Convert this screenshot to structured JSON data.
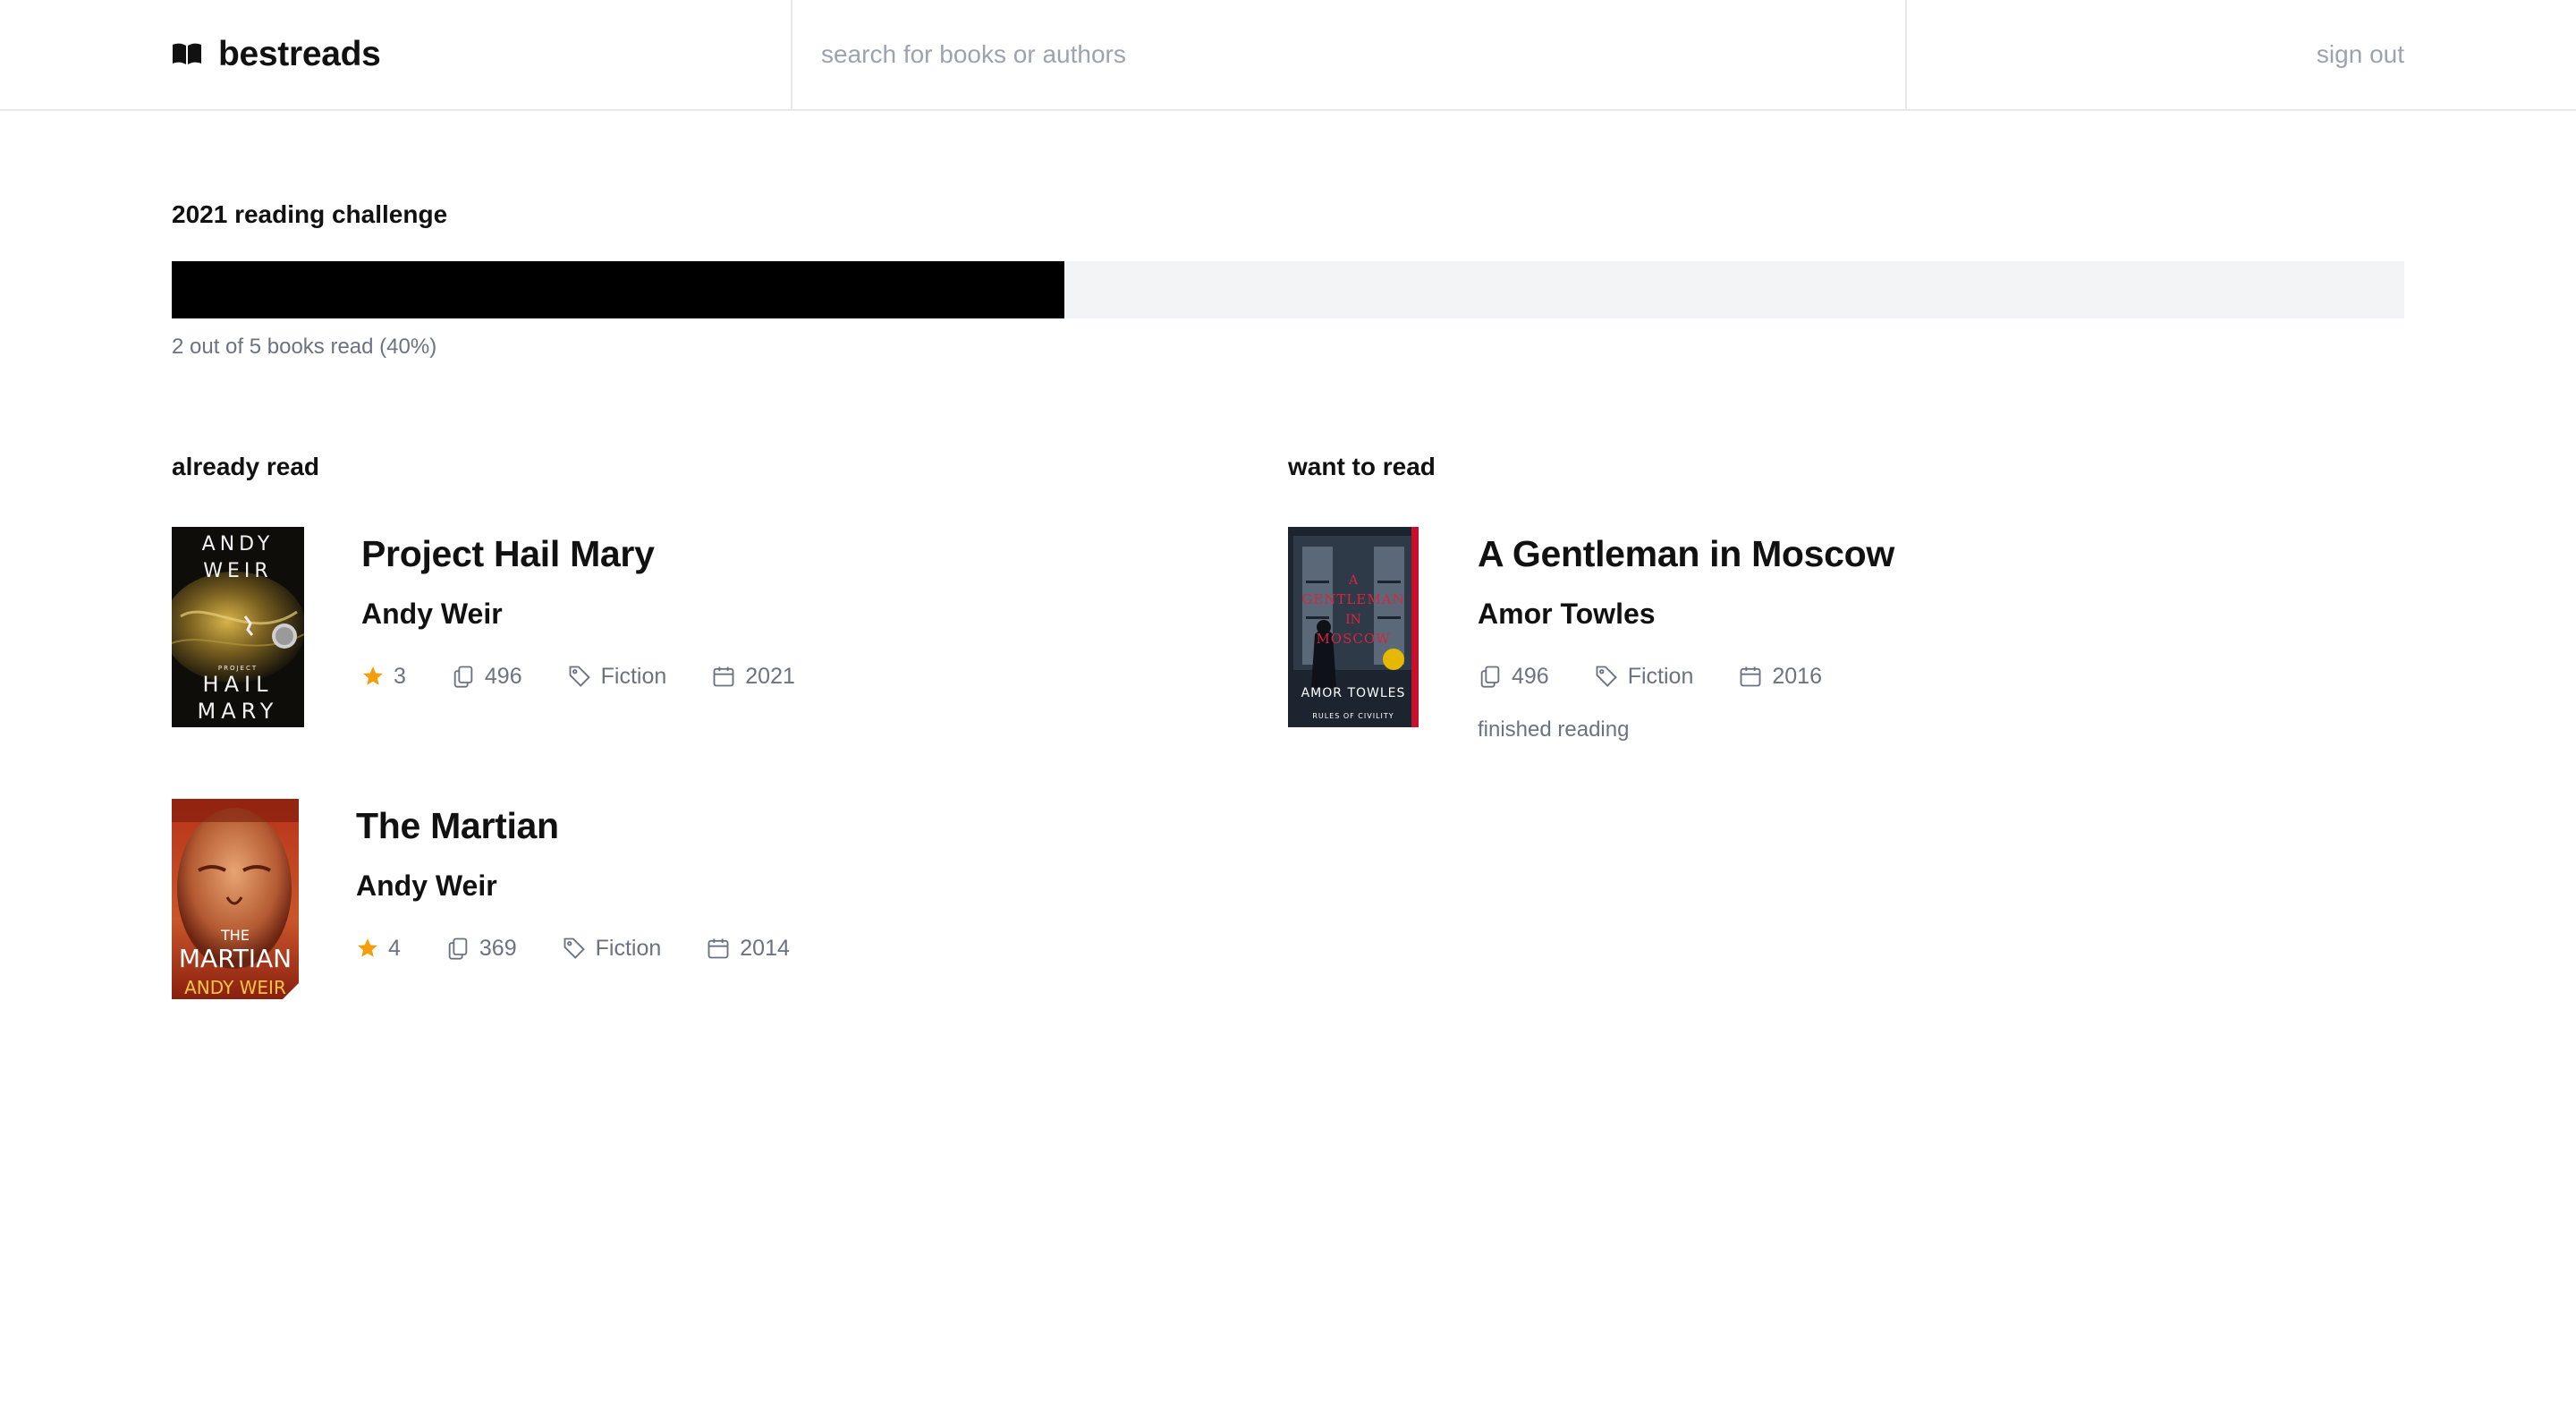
{
  "app": {
    "name": "bestreads",
    "logo_icon": "open-book-icon"
  },
  "header": {
    "search_placeholder": "search for books or authors",
    "search_value": "",
    "signout_label": "sign out"
  },
  "challenge": {
    "title": "2021 reading challenge",
    "books_read": 2,
    "books_goal": 5,
    "percent": 40,
    "progress_text": "2 out of 5 books read (40%)",
    "bar_color": "#000000",
    "track_color": "#f3f4f6"
  },
  "sections": {
    "already_read": {
      "title": "already read",
      "books": [
        {
          "title": "Project Hail Mary",
          "author": "Andy Weir",
          "rating": "3",
          "pages": "496",
          "genre": "Fiction",
          "year": "2021",
          "cover": {
            "top_text": [
              "ANDY",
              "WEIR"
            ],
            "small_text": "PROJECT",
            "bottom_text": [
              "HAIL",
              "MARY"
            ]
          }
        },
        {
          "title": "The Martian",
          "author": "Andy Weir",
          "rating": "4",
          "pages": "369",
          "genre": "Fiction",
          "year": "2014",
          "cover": {
            "title_text": [
              "THE",
              "MARTIAN"
            ],
            "author_text": "ANDY WEIR"
          }
        }
      ]
    },
    "want_to_read": {
      "title": "want to read",
      "books": [
        {
          "title": "A Gentleman in Moscow",
          "author": "Amor Towles",
          "pages": "496",
          "genre": "Fiction",
          "year": "2016",
          "status": "finished reading",
          "cover": {
            "title_text": [
              "A",
              "GENTLEMAN",
              "IN",
              "MOSCOW"
            ],
            "author_text": "AMOR TOWLES",
            "small_text": "RULES OF CIVILITY"
          }
        }
      ]
    }
  },
  "colors": {
    "star": "#f59e0b",
    "muted_text": "#6b7280",
    "border": "#e5e7eb"
  }
}
